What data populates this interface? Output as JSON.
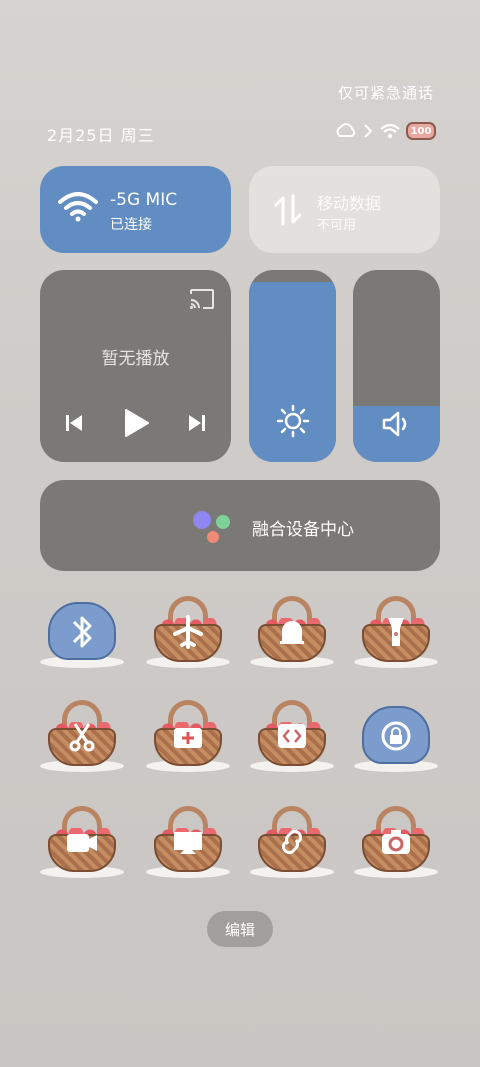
{
  "header": {
    "emergency_text": "仅可紧急通话",
    "date_text": "2月25日 周三",
    "battery_level": "100"
  },
  "tiles": {
    "wifi": {
      "ssid": "-5G   MIC",
      "status": "已连接"
    },
    "mobile_data": {
      "title": "移动数据",
      "status": "不可用"
    },
    "media": {
      "status": "暂无播放"
    },
    "brightness": {
      "level": 0.94
    },
    "volume": {
      "level": 0.29
    },
    "device_center": {
      "label": "融合设备中心"
    }
  },
  "quick_toggles": [
    {
      "icon": "bluetooth-icon",
      "style": "cloud"
    },
    {
      "icon": "airplane-icon",
      "style": "basket"
    },
    {
      "icon": "bell-icon",
      "style": "basket"
    },
    {
      "icon": "flashlight-icon",
      "style": "basket"
    },
    {
      "icon": "screenshot-icon",
      "style": "basket"
    },
    {
      "icon": "medical-icon",
      "style": "basket"
    },
    {
      "icon": "code-icon",
      "style": "basket"
    },
    {
      "icon": "lock-rotation-icon",
      "style": "cloud"
    },
    {
      "icon": "video-icon",
      "style": "basket"
    },
    {
      "icon": "cast-screen-icon",
      "style": "basket"
    },
    {
      "icon": "link-icon",
      "style": "basket"
    },
    {
      "icon": "camera-icon",
      "style": "basket"
    }
  ],
  "footer": {
    "edit_label": "编辑"
  },
  "colors": {
    "accent_blue": "#628dc2",
    "tile_gray": "#7b7976"
  }
}
